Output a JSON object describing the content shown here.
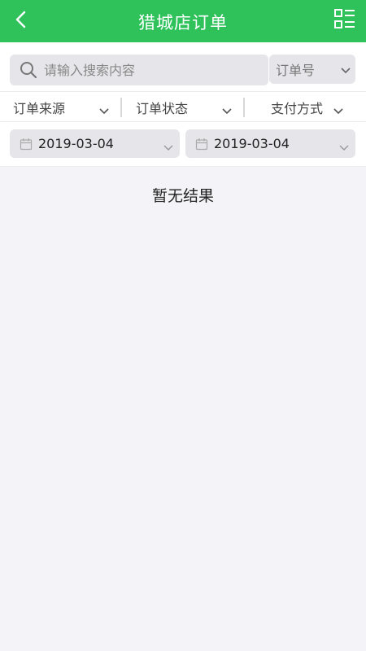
{
  "header": {
    "title": "猎城店订单",
    "back_icon": "chevron-left-icon",
    "menu_icon": "list-menu-icon",
    "color": "#2fc25b"
  },
  "search": {
    "placeholder": "请输入搜索内容",
    "value": "",
    "type_selected": "订单号"
  },
  "filters": [
    {
      "label": "订单来源"
    },
    {
      "label": "订单状态"
    },
    {
      "label": "支付方式"
    }
  ],
  "date_range": {
    "start": "2019-03-04",
    "end": "2019-03-04"
  },
  "results": {
    "empty_message": "暂无结果"
  }
}
